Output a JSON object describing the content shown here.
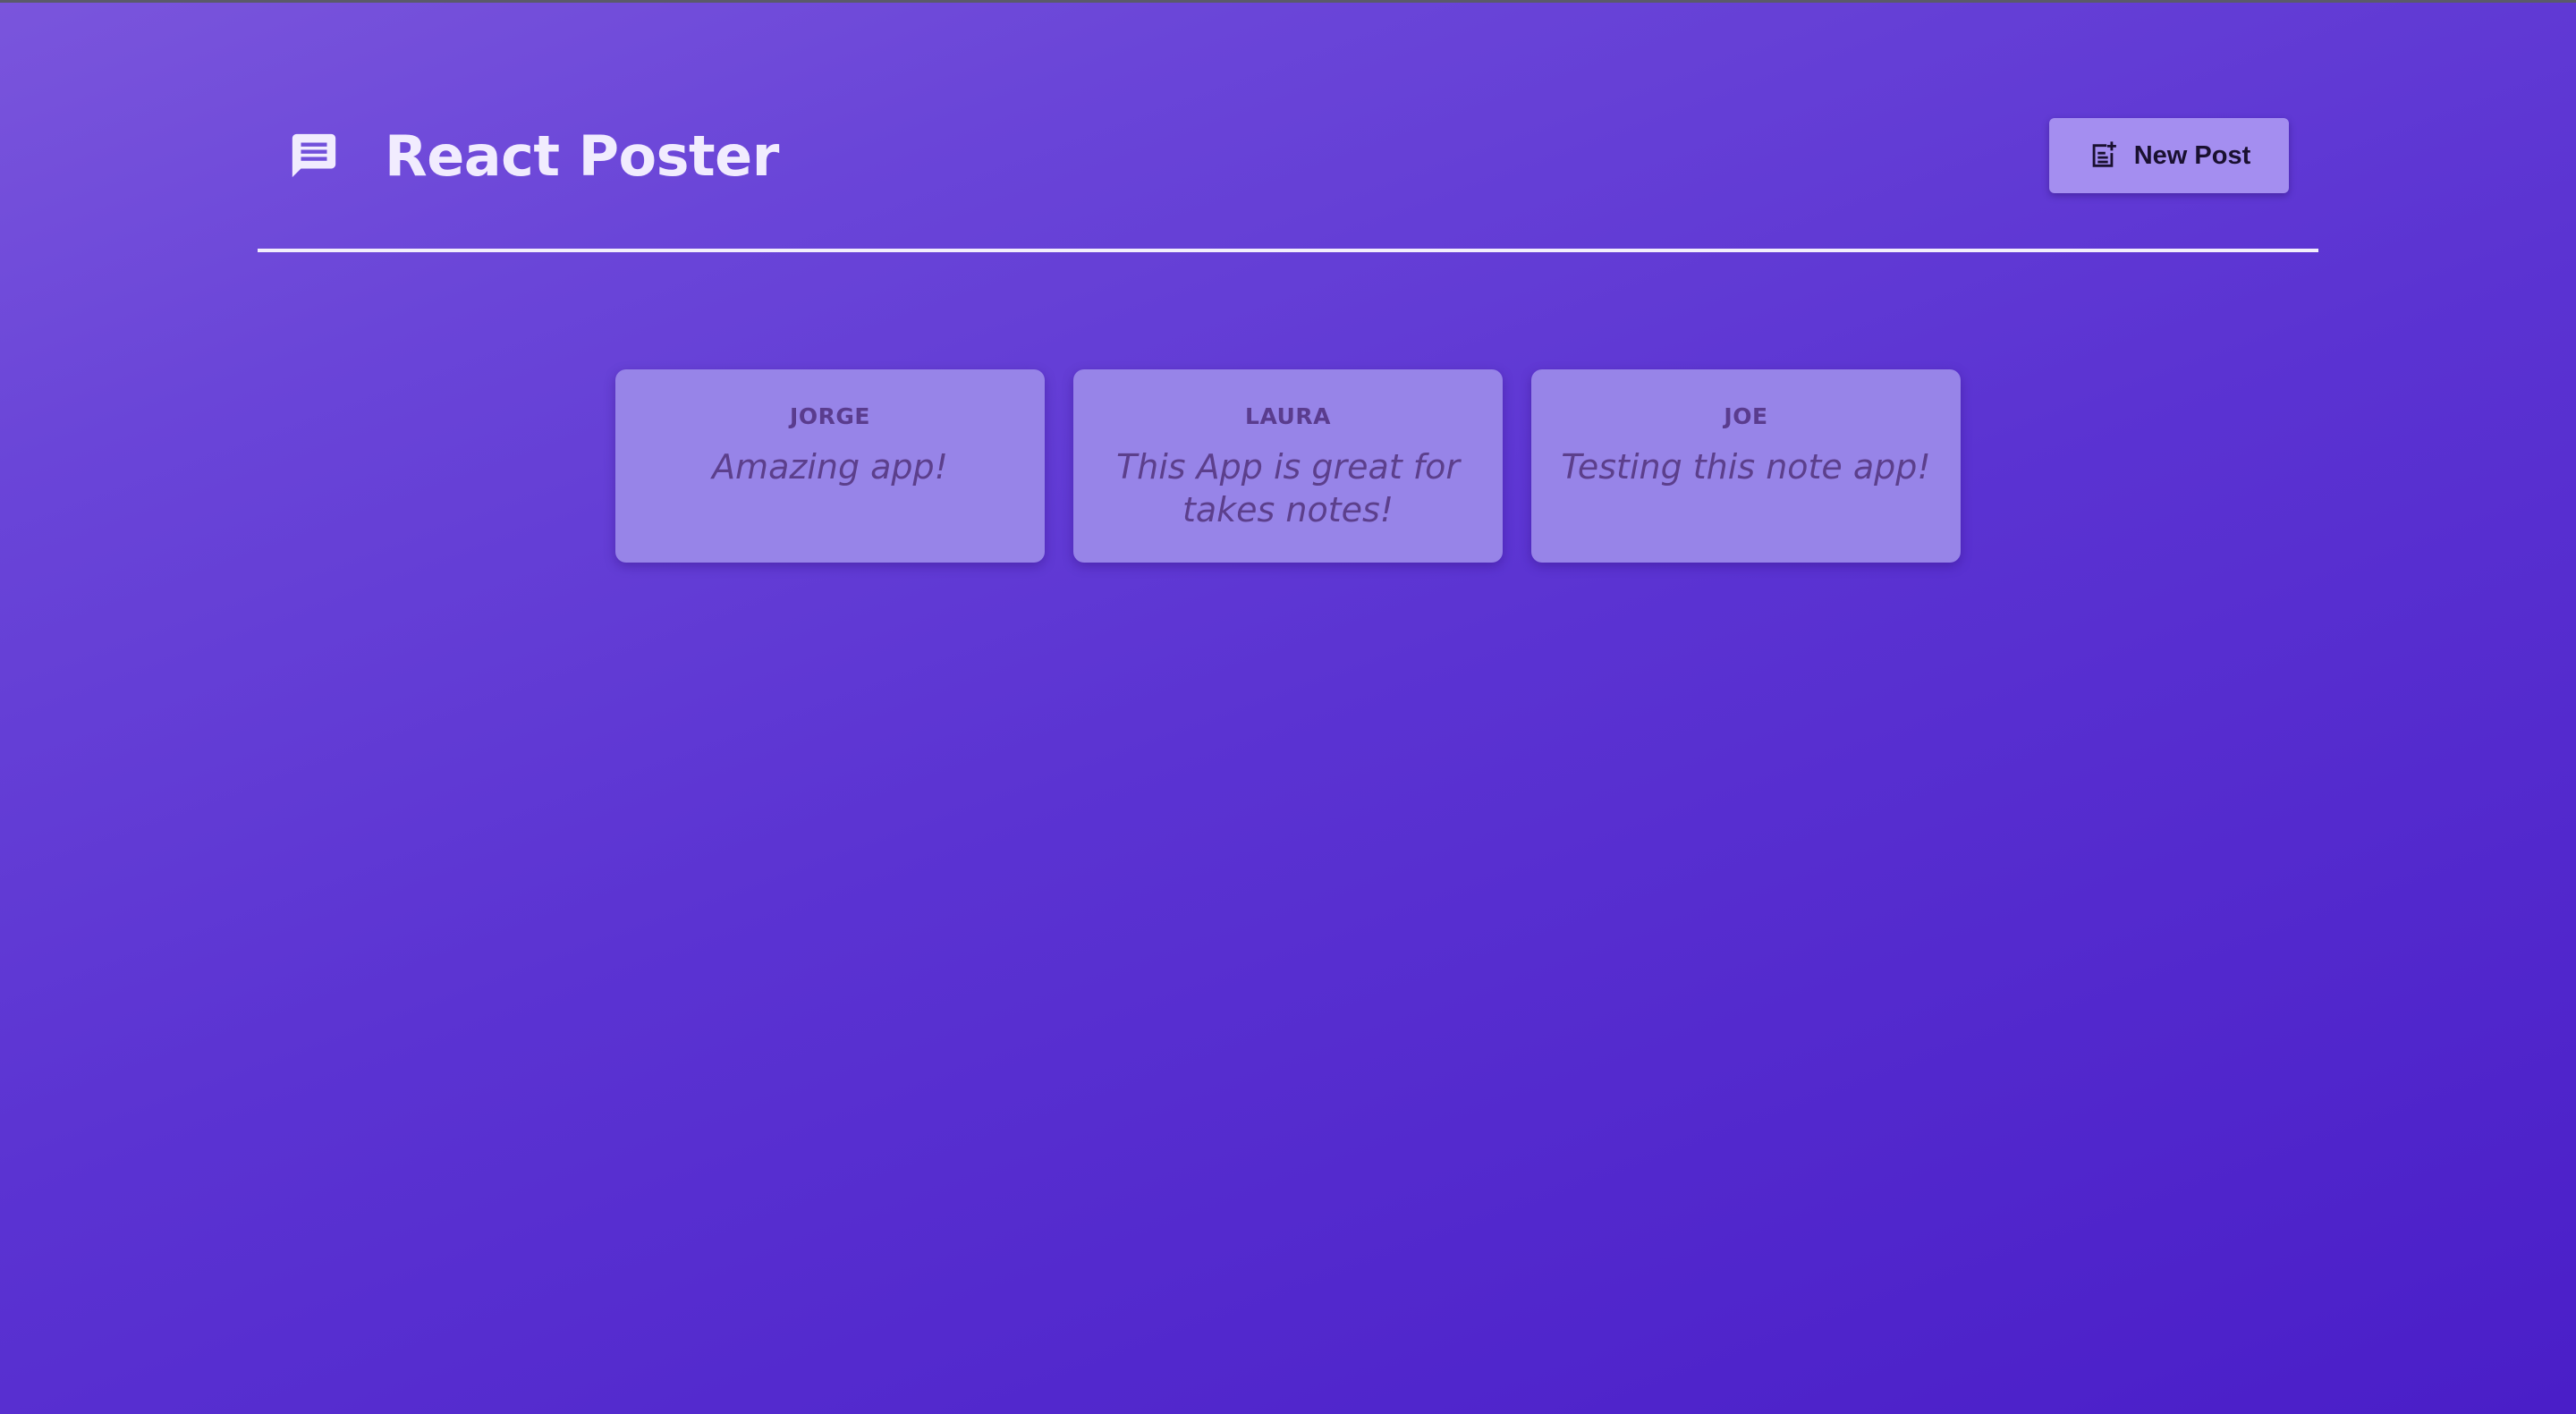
{
  "header": {
    "title": "React Poster",
    "logo_icon": "message-icon",
    "new_post_label": "New Post",
    "new_post_icon": "note-add-icon"
  },
  "posts": [
    {
      "author": "JORGE",
      "body": "Amazing app!"
    },
    {
      "author": "LAURA",
      "body": "This App is great for takes notes!"
    },
    {
      "author": "JOE",
      "body": "Testing this note app!"
    }
  ],
  "colors": {
    "background_start": "#7a55dc",
    "background_end": "#4a1ec8",
    "card": "#9784e8",
    "button": "#a48ef0",
    "header_text": "#f1ecfe",
    "card_text": "#5c3f8c"
  }
}
